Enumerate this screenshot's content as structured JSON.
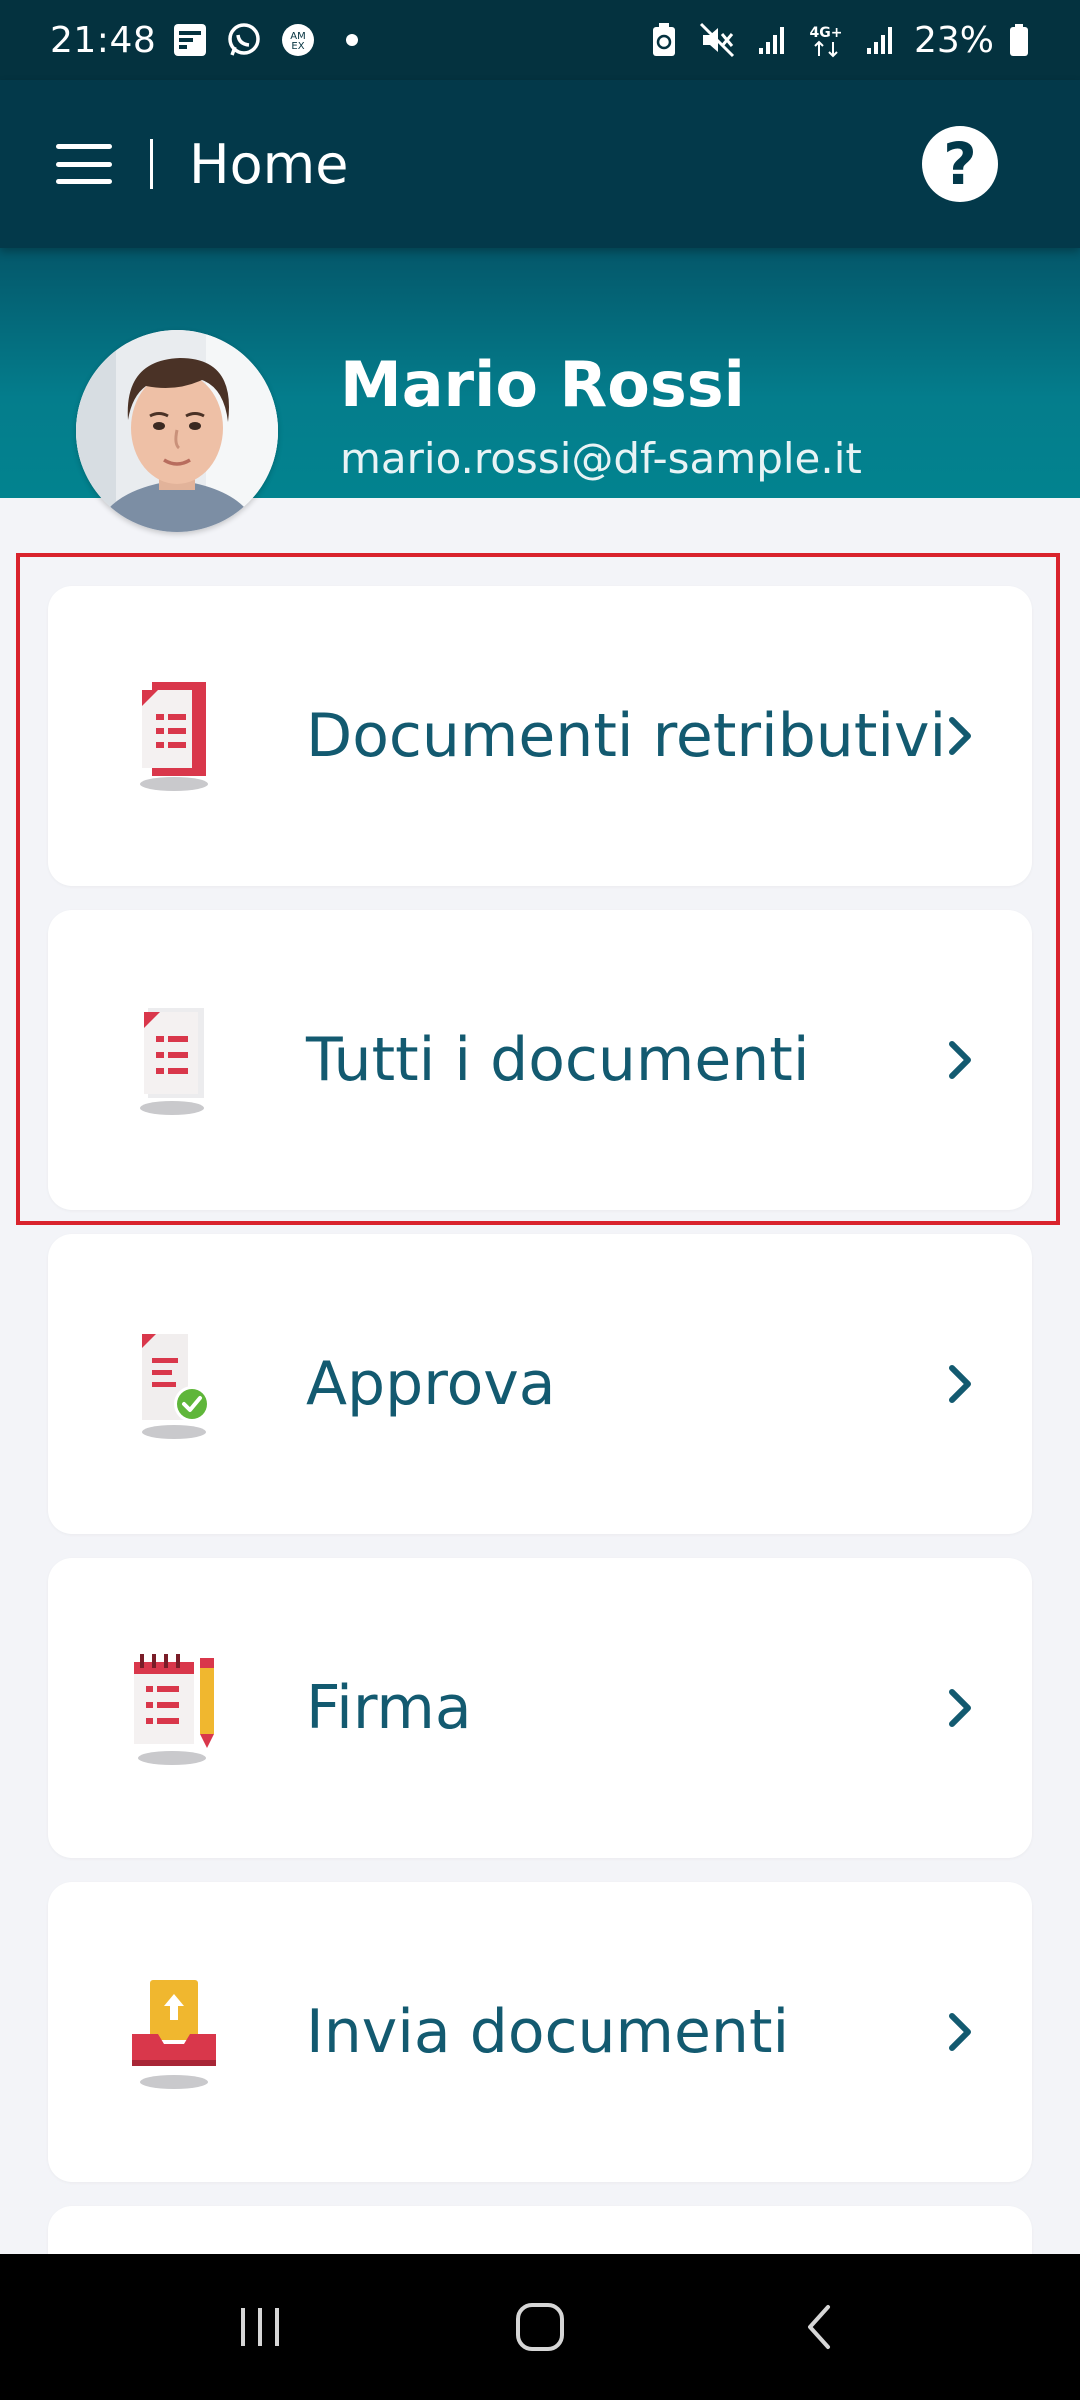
{
  "status_bar": {
    "time": "21:48",
    "battery_percent": "23%",
    "notification_icons": [
      "flipboard-icon",
      "whatsapp-icon",
      "amex-icon",
      "dot-icon"
    ],
    "system_icons": [
      "battery-saver-icon",
      "mute-icon",
      "signal-icon",
      "4g-icon",
      "signal-icon",
      "battery-icon"
    ]
  },
  "app_bar": {
    "title": "Home",
    "menu_icon": "menu-icon",
    "help_icon": "help-icon",
    "help_glyph": "?"
  },
  "profile": {
    "name": "Mario Rossi",
    "email": "mario.rossi@df-sample.it"
  },
  "menu": {
    "items": [
      {
        "label": "Documenti retributivi",
        "icon": "payslip-document-icon"
      },
      {
        "label": "Tutti i documenti",
        "icon": "document-icon"
      },
      {
        "label": "Approva",
        "icon": "approve-document-icon"
      },
      {
        "label": "Firma",
        "icon": "sign-document-icon"
      },
      {
        "label": "Invia documenti",
        "icon": "upload-tray-icon"
      }
    ]
  },
  "colors": {
    "app_bar": "#03394a",
    "header_teal": "#047d8c",
    "label": "#135a70",
    "highlight": "#d9232d",
    "icon_red": "#d9374b"
  }
}
